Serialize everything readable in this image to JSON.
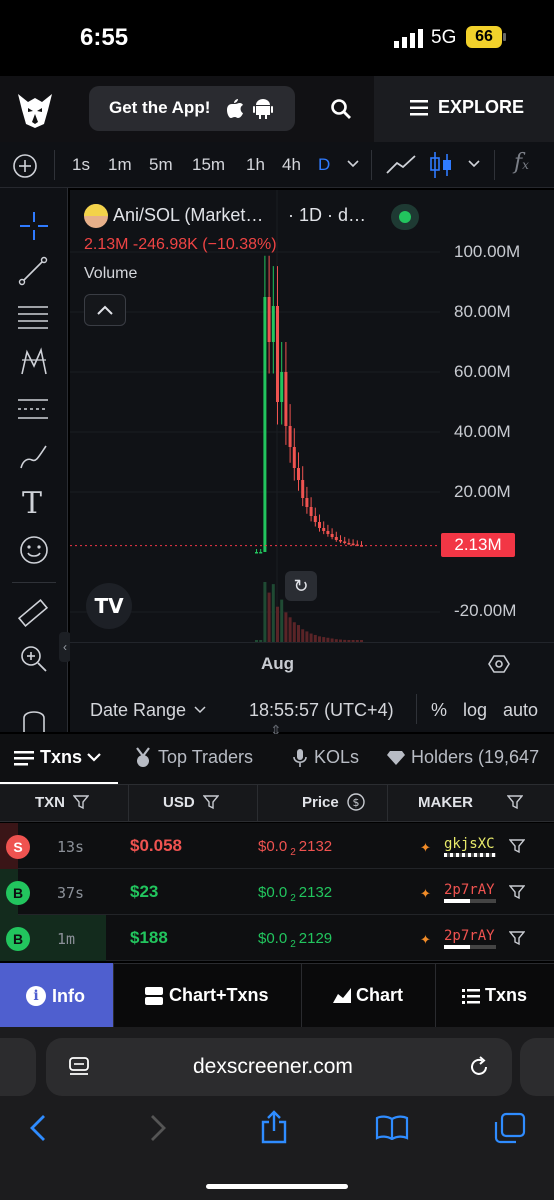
{
  "status": {
    "time": "6:55",
    "network": "5G",
    "battery": "66"
  },
  "header": {
    "get_app": "Get the App!",
    "explore": "EXPLORE"
  },
  "timeframes": [
    "1s",
    "1m",
    "5m",
    "15m",
    "1h",
    "4h",
    "D"
  ],
  "timeframe_selected": "D",
  "chart": {
    "legend_title": "Ani/SOL (Market…",
    "legend_interval": "· 1D · d…",
    "legend_values": "2.13M  -246.98K (−10.38%)",
    "volume_label": "Volume",
    "price_ticks": [
      "100.00M",
      "80.00M",
      "60.00M",
      "40.00M",
      "20.00M",
      "-20.00M"
    ],
    "last_price": "2.13M",
    "date_label": "Aug",
    "date_range": "Date Range",
    "time": "18:55:57 (UTC+4)",
    "pct": "%",
    "log": "log",
    "auto": "auto",
    "colors": {
      "up": "#22c55e",
      "down": "#ef5350",
      "last_price_bg": "#f23645"
    }
  },
  "chart_data": {
    "type": "line",
    "title": "Ani/SOL (Market…",
    "y_axis_ticks": [
      "100.00M",
      "80.00M",
      "60.00M",
      "40.00M",
      "20.00M",
      "-20.00M"
    ],
    "last_value": "2.13M",
    "x_label": "Aug",
    "price_series": [
      0,
      0,
      85,
      70,
      82,
      50,
      60,
      42,
      35,
      28,
      24,
      18,
      15,
      12,
      10,
      8,
      7,
      6,
      5,
      4,
      3.5,
      3,
      2.8,
      2.5,
      2.3,
      2.13
    ]
  },
  "tabs": {
    "txns": "Txns",
    "top_traders": "Top Traders",
    "kols": "KOLs",
    "holders": "Holders (19,647"
  },
  "table": {
    "headers": [
      "TXN",
      "USD",
      "Price",
      "MAKER"
    ],
    "rows": [
      {
        "type": "S",
        "age": "13s",
        "usd": "$0.058",
        "price_pre": "$0.0",
        "price_sub": "2",
        "price_post": "2132",
        "maker": "gkjsXC"
      },
      {
        "type": "B",
        "age": "37s",
        "usd": "$23",
        "price_pre": "$0.0",
        "price_sub": "2",
        "price_post": "2132",
        "maker": "2p7rAY"
      },
      {
        "type": "B",
        "age": "1m",
        "usd": "$188",
        "price_pre": "$0.0",
        "price_sub": "2",
        "price_post": "2129",
        "maker": "2p7rAY"
      }
    ]
  },
  "nav": {
    "info": "Info",
    "chart_txns": "Chart+Txns",
    "chart": "Chart",
    "txns": "Txns"
  },
  "browser": {
    "url": "dexscreener.com"
  }
}
